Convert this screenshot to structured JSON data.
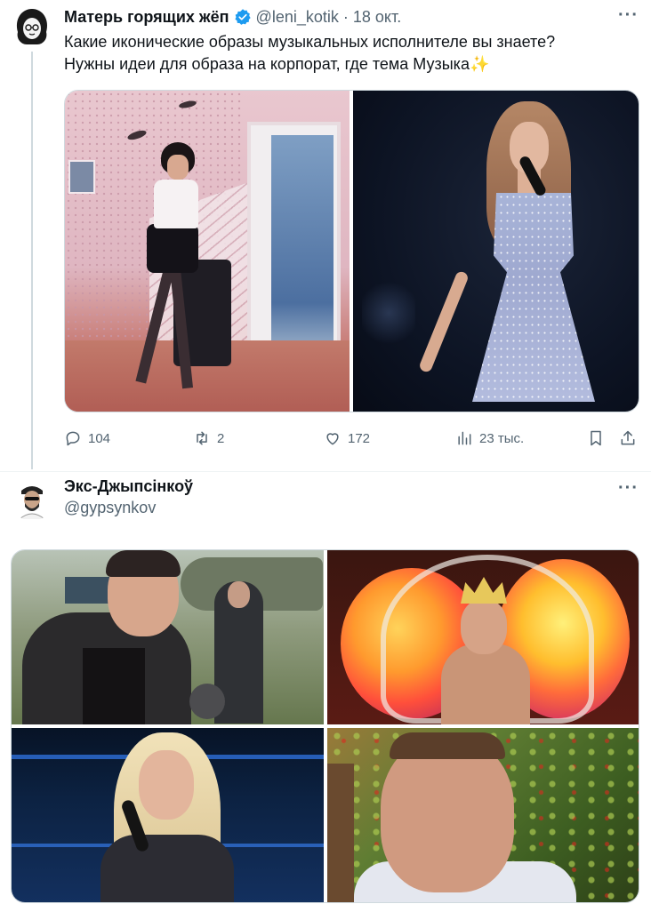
{
  "tweet1": {
    "author_name": "Матерь горящих жёп",
    "verified_icon": "verified-badge-icon",
    "handle": "@leni_kotik",
    "separator": "·",
    "date": "18 окт.",
    "more_icon": "more-horizontal-icon",
    "more_label": "···",
    "text_line1": "Какие иконические образы музыкальных исполнителе вы знаете?",
    "text_line2": "Нужны идеи для образа на корпорат, где тема Музыка",
    "sparkle_emoji": "✨",
    "media_count": 2,
    "actions": {
      "reply_count": "104",
      "retweet_count": "2",
      "like_count": "172",
      "views_count": "23 тыс.",
      "icons": [
        "reply-icon",
        "retweet-icon",
        "like-icon",
        "views-icon",
        "bookmark-icon",
        "share-icon"
      ]
    }
  },
  "tweet2": {
    "author_name": "Экс-Джыпсінкоў",
    "handle": "@gypsynkov",
    "more_icon": "more-horizontal-icon",
    "more_label": "···",
    "media_count": 4
  },
  "colors": {
    "text_primary": "#0f1419",
    "text_secondary": "#536471",
    "verified_blue": "#1d9bf0",
    "border": "#cfd9de"
  }
}
